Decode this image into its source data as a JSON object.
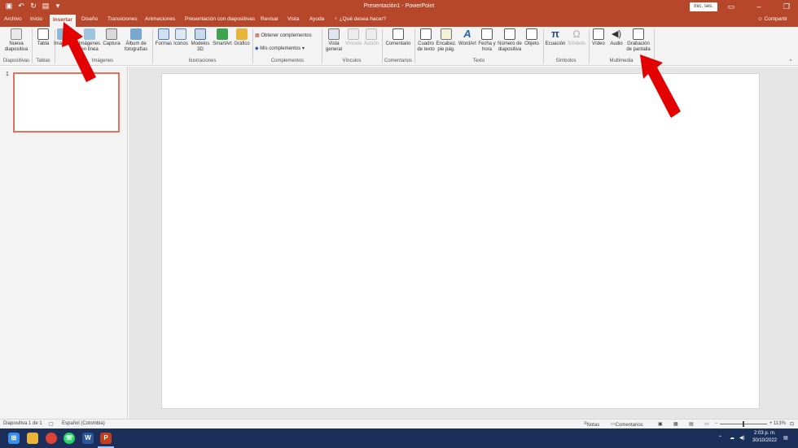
{
  "window": {
    "title": "Presentación1 - PowerPoint",
    "signin": "Inic. ses.",
    "share": "Compartir"
  },
  "tabs": [
    "Archivo",
    "Inicio",
    "Insertar",
    "Diseño",
    "Transiciones",
    "Animaciones",
    "Presentación con diapositivas",
    "Revisar",
    "Vista",
    "Ayuda"
  ],
  "active_tab": "Insertar",
  "tell_me": "¿Qué desea hacer?",
  "ribbon": {
    "diapositivas": {
      "new_slide": "Nueva diapositiva",
      "label": "Diapositivas"
    },
    "tablas": {
      "table": "Tabla",
      "label": "Tablas"
    },
    "imagenes": {
      "images": "Imágenes",
      "online": "Imágenes en línea",
      "capture": "Captura",
      "album": "Álbum de fotografías",
      "label": "Imágenes"
    },
    "ilustraciones": {
      "shapes": "Formas",
      "icons": "Iconos",
      "models": "Modelos 3D",
      "smartart": "SmartArt",
      "chart": "Gráfico",
      "label": "Ilustraciones"
    },
    "complementos": {
      "get": "Obtener complementos",
      "mine": "Mis complementos",
      "label": "Complementos"
    },
    "vinculos": {
      "zoom": "Vista general",
      "link": "Vínculo",
      "action": "Acción",
      "label": "Vínculos"
    },
    "comentarios": {
      "comment": "Comentario",
      "label": "Comentarios"
    },
    "texto": {
      "textbox": "Cuadro de texto",
      "header": "Encabez. pie pág.",
      "wordart": "WordArt",
      "date": "Fecha y hora",
      "slidenum": "Número de diapositiva",
      "object": "Objeto",
      "label": "Texto"
    },
    "simbolos": {
      "equation": "Ecuación",
      "symbol": "Símbolo",
      "label": "Símbolos"
    },
    "multimedia": {
      "video": "Vídeo",
      "audio": "Audio",
      "record": "Grabación de pantalla",
      "label": "Multimedia"
    }
  },
  "slides": {
    "thumb_number": "1"
  },
  "status": {
    "slide": "Diapositiva 1 de 1",
    "lang": "Español (Colombia)",
    "notes": "Notas",
    "comments": "Comentarios",
    "zoom": "113%"
  },
  "taskbar": {
    "time": "2:03 p. m.",
    "date": "30/10/2022"
  },
  "colors": {
    "accent": "#b7472a",
    "arrow": "#e30000"
  }
}
